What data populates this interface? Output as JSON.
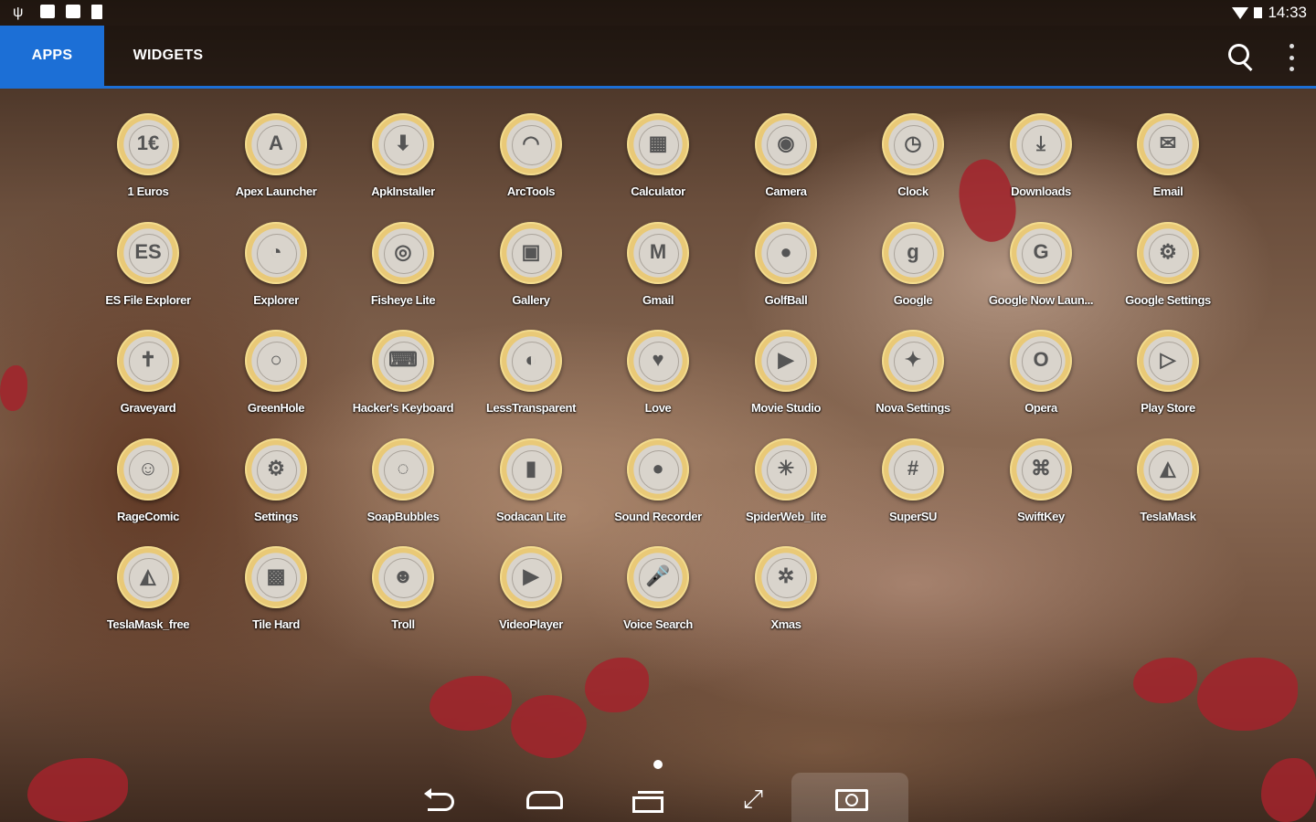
{
  "status_bar": {
    "time": "14:33",
    "left_icons": [
      "usb-icon",
      "notification-icon",
      "notification-icon",
      "sd-card-icon"
    ],
    "right_icons": [
      "wifi-icon",
      "battery-icon"
    ]
  },
  "tabs": [
    {
      "label": "APPS",
      "active": true
    },
    {
      "label": "WIDGETS",
      "active": false
    }
  ],
  "toolbar": {
    "icons": [
      "search-icon",
      "overflow-menu-icon"
    ]
  },
  "accent_color": "#1c6fd6",
  "apps": [
    {
      "label": "1 Euros",
      "glyph": "1€"
    },
    {
      "label": "Apex Launcher",
      "glyph": "A"
    },
    {
      "label": "ApkInstaller",
      "glyph": "⬇"
    },
    {
      "label": "ArcTools",
      "glyph": "◠"
    },
    {
      "label": "Calculator",
      "glyph": "▦"
    },
    {
      "label": "Camera",
      "glyph": "◉"
    },
    {
      "label": "Clock",
      "glyph": "◷"
    },
    {
      "label": "Downloads",
      "glyph": "⤓"
    },
    {
      "label": "Email",
      "glyph": "✉"
    },
    {
      "label": "ES File Explorer",
      "glyph": "ES"
    },
    {
      "label": "Explorer",
      "glyph": "◔"
    },
    {
      "label": "Fisheye Lite",
      "glyph": "◎"
    },
    {
      "label": "Gallery",
      "glyph": "▣"
    },
    {
      "label": "Gmail",
      "glyph": "M"
    },
    {
      "label": "GolfBall",
      "glyph": "●"
    },
    {
      "label": "Google",
      "glyph": "g"
    },
    {
      "label": "Google Now Laun...",
      "glyph": "G"
    },
    {
      "label": "Google Settings",
      "glyph": "⚙"
    },
    {
      "label": "Graveyard",
      "glyph": "✝"
    },
    {
      "label": "GreenHole",
      "glyph": "○"
    },
    {
      "label": "Hacker's Keyboard",
      "glyph": "⌨"
    },
    {
      "label": "LessTransparent",
      "glyph": "◐"
    },
    {
      "label": "Love",
      "glyph": "♥"
    },
    {
      "label": "Movie Studio",
      "glyph": "▶"
    },
    {
      "label": "Nova Settings",
      "glyph": "✦"
    },
    {
      "label": "Opera",
      "glyph": "O"
    },
    {
      "label": "Play Store",
      "glyph": "▷"
    },
    {
      "label": "RageComic",
      "glyph": "☺"
    },
    {
      "label": "Settings",
      "glyph": "⚙"
    },
    {
      "label": "SoapBubbles",
      "glyph": "◌"
    },
    {
      "label": "Sodacan Lite",
      "glyph": "▮"
    },
    {
      "label": "Sound Recorder",
      "glyph": "●"
    },
    {
      "label": "SpiderWeb_lite",
      "glyph": "✳"
    },
    {
      "label": "SuperSU",
      "glyph": "#"
    },
    {
      "label": "SwiftKey",
      "glyph": "⌘"
    },
    {
      "label": "TeslaMask",
      "glyph": "◭"
    },
    {
      "label": "TeslaMask_free",
      "glyph": "◭"
    },
    {
      "label": "Tile Hard",
      "glyph": "▩"
    },
    {
      "label": "Troll",
      "glyph": "☻"
    },
    {
      "label": "VideoPlayer",
      "glyph": "▶"
    },
    {
      "label": "Voice Search",
      "glyph": "🎤"
    },
    {
      "label": "Xmas",
      "glyph": "✲"
    }
  ],
  "nav_bar": {
    "icons": [
      "back-icon",
      "home-icon",
      "recents-icon",
      "expand-icon",
      "screenshot-icon"
    ],
    "expand_glyph": "⤢"
  }
}
